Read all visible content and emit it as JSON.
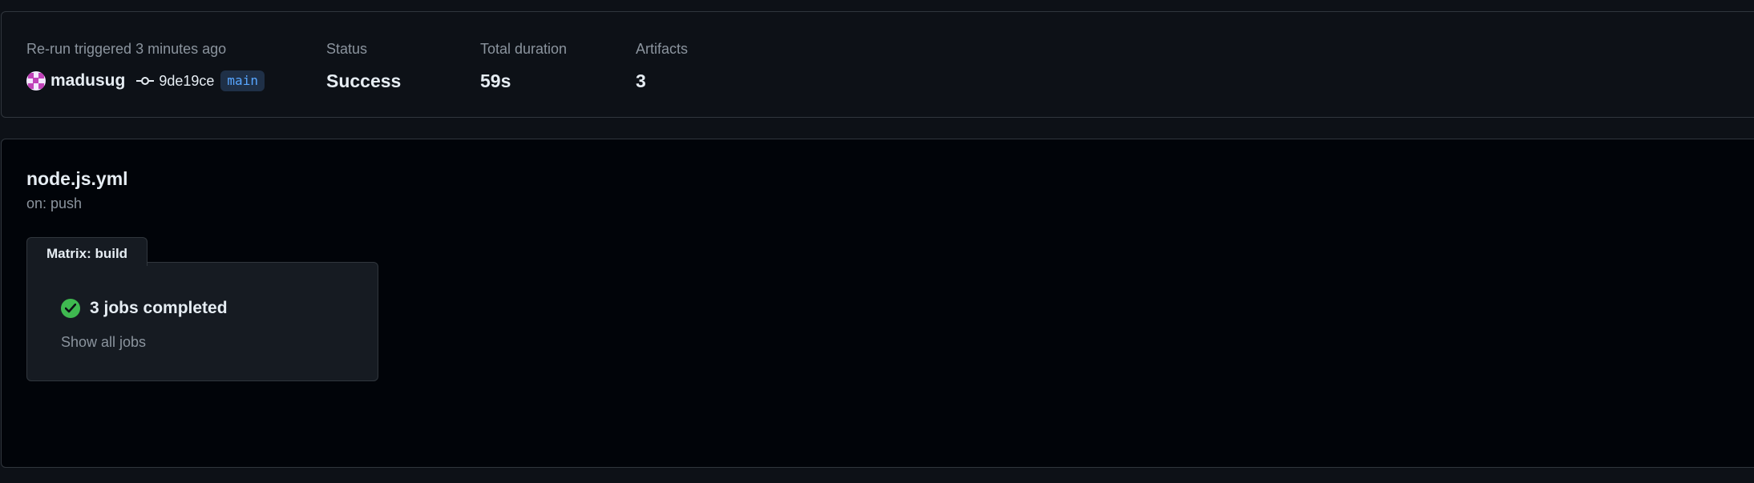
{
  "summary": {
    "trigger_label": "Re-run triggered 3 minutes ago",
    "actor": "madusug",
    "commit_sha": "9de19ce",
    "branch": "main",
    "status_label": "Status",
    "status_value": "Success",
    "duration_label": "Total duration",
    "duration_value": "59s",
    "artifacts_label": "Artifacts",
    "artifacts_value": "3"
  },
  "workflow": {
    "file_name": "node.js.yml",
    "trigger": "on: push",
    "matrix": {
      "tab_label": "Matrix: build",
      "jobs_status": "3 jobs completed",
      "show_all_label": "Show all jobs"
    }
  },
  "colors": {
    "success": "#3fb950",
    "branch_text": "#58a6ff",
    "branch_bg": "#1f3047",
    "avatar": "#c042b8"
  },
  "icons": {
    "avatar": "identicon-avatar",
    "commit": "git-commit-icon",
    "status": "check-circle-icon"
  }
}
